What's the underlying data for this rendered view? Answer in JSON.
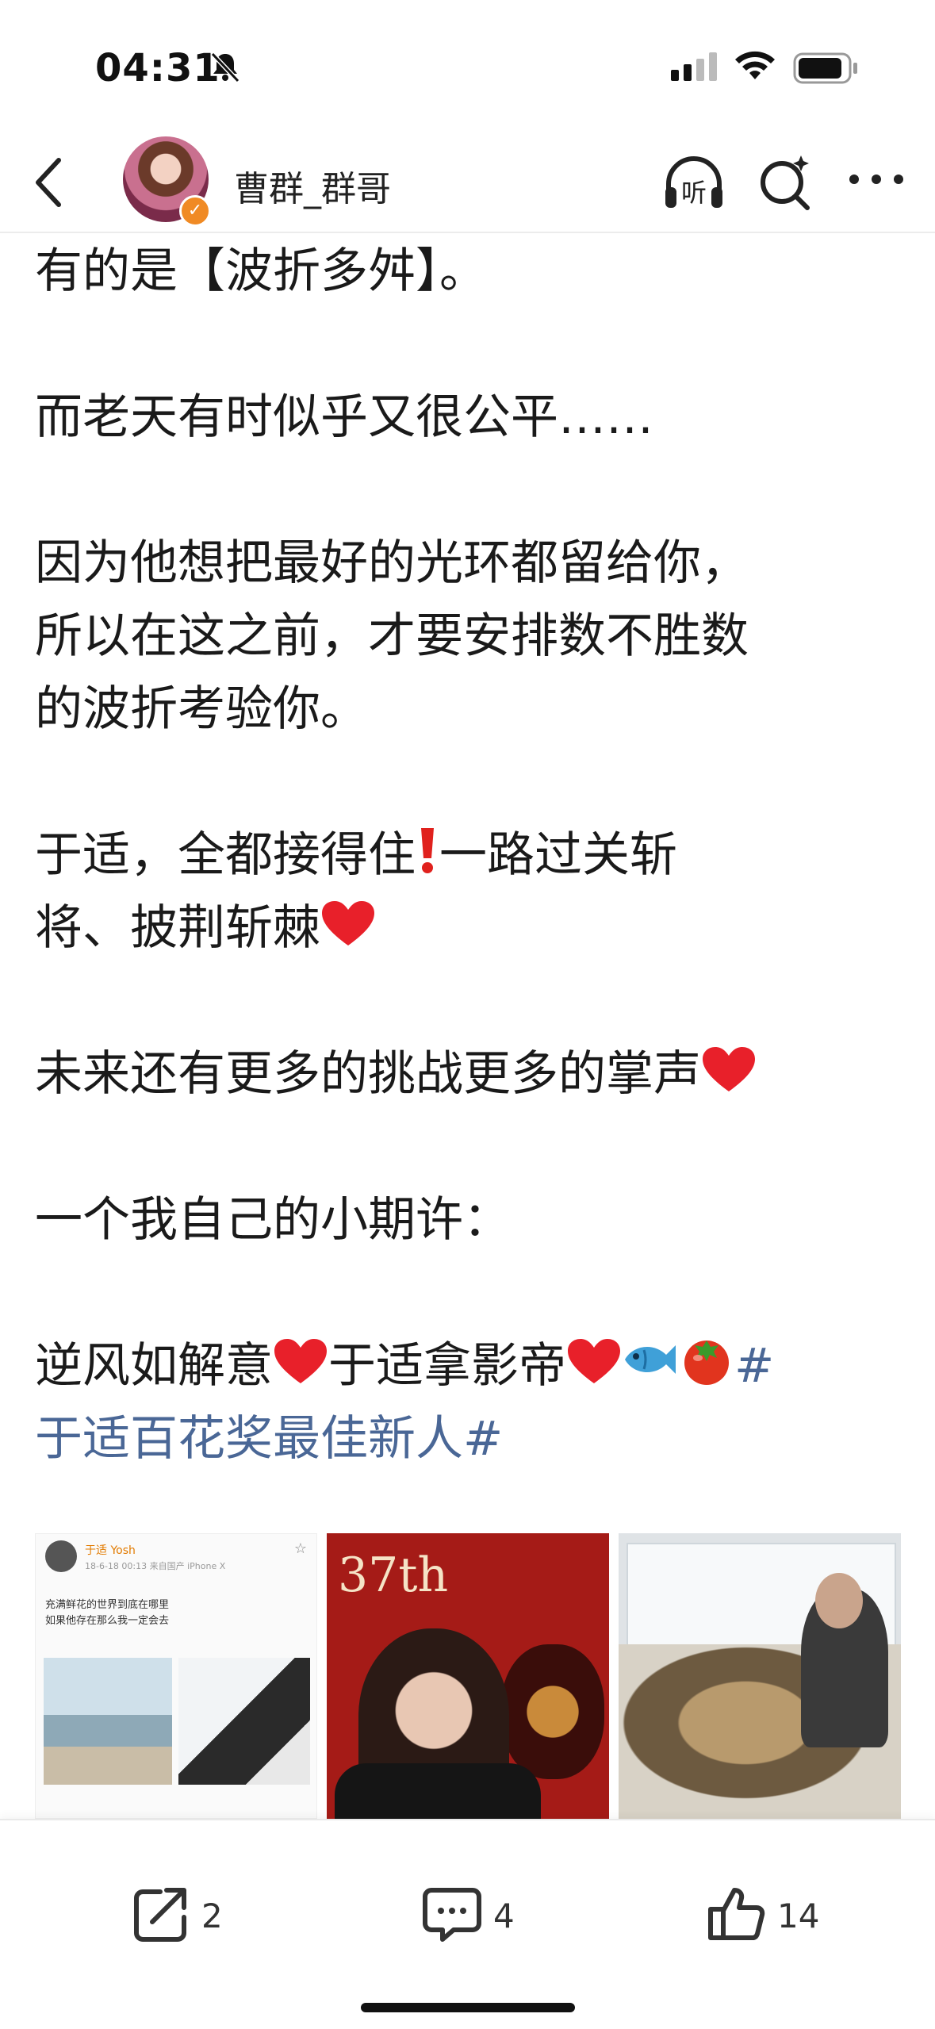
{
  "status_bar": {
    "time": "04:31"
  },
  "header": {
    "username": "曹群_群哥",
    "listen_label": "听"
  },
  "post": {
    "lines": [
      "有的是【波折多舛】。",
      "而老天有时似乎又很公平……",
      "因为他想把最好的光环都留给你，",
      "所以在这之前，才要安排数不胜数",
      "的波折考验你。",
      "于适，全都接得住",
      "一路过关斩",
      "将、披荆斩棘",
      "未来还有更多的挑战更多的掌声",
      "一个我自己的小期许：",
      "逆风如解意",
      "于适拿影帝",
      "#",
      "于适百花奖最佳新人#"
    ]
  },
  "images": {
    "thumb1": {
      "name": "于适 Yosh",
      "meta": "18-6-18 00:13 来自国产 iPhone X",
      "text_lines": [
        "充满鲜花的世界到底在哪里",
        "如果他存在那么我一定会去"
      ]
    },
    "thumb2": {
      "badge": "37th"
    }
  },
  "actions": {
    "shares": "2",
    "comments": "4",
    "likes": "14"
  },
  "colors": {
    "tag": "#4a6796",
    "verify": "#f08a24"
  }
}
